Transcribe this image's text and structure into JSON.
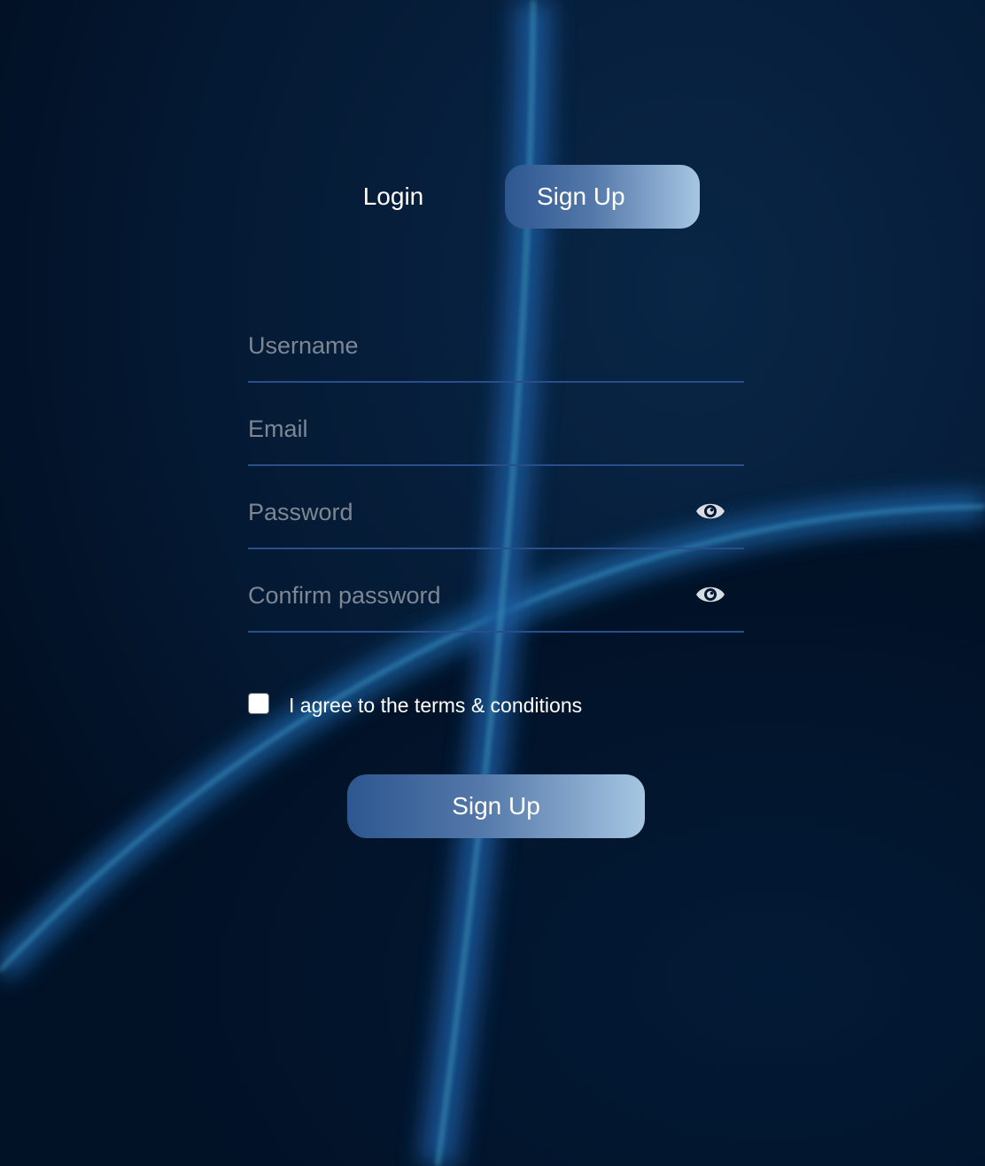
{
  "tabs": {
    "login_label": "Login",
    "signup_label": "Sign Up",
    "active": "Sign Up"
  },
  "form": {
    "username": {
      "value": "",
      "placeholder": "Username"
    },
    "email": {
      "value": "",
      "placeholder": "Email"
    },
    "password": {
      "value": "",
      "placeholder": "Password",
      "toggle_icon": "eye-icon"
    },
    "confirm_password": {
      "value": "",
      "placeholder": "Confirm password",
      "toggle_icon": "eye-icon"
    },
    "terms": {
      "checked": false,
      "label": "I agree to the terms & conditions"
    },
    "submit_label": "Sign Up"
  },
  "theme": {
    "background": "#021026",
    "underline": "#2a4e8c",
    "button_gradient_start": "#2d5790",
    "button_gradient_end": "#a6c6e2",
    "placeholder": "#7d8794",
    "text": "#ffffff"
  }
}
